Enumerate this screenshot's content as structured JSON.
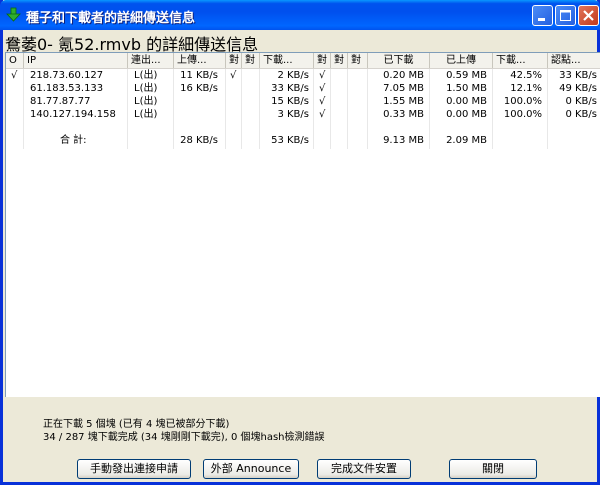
{
  "window": {
    "title": "種子和下載者的詳細傳送信息"
  },
  "file_title": "鴦萎0- 氪52.rmvb 的詳細傳送信息",
  "columns": [
    {
      "key": "o",
      "label": "O"
    },
    {
      "key": "ip",
      "label": "IP"
    },
    {
      "key": "conn",
      "label": "連出..."
    },
    {
      "key": "up",
      "label": "上傳..."
    },
    {
      "key": "c1",
      "label": "對"
    },
    {
      "key": "c2",
      "label": "對"
    },
    {
      "key": "down",
      "label": "下載..."
    },
    {
      "key": "c3",
      "label": "對"
    },
    {
      "key": "c4",
      "label": "對"
    },
    {
      "key": "c5",
      "label": "對"
    },
    {
      "key": "downloaded",
      "label": "已下載"
    },
    {
      "key": "uploaded",
      "label": "已上傳"
    },
    {
      "key": "dlpct",
      "label": "下載..."
    },
    {
      "key": "rate",
      "label": "認點..."
    }
  ],
  "rows": [
    {
      "o": "√",
      "ip": "218.73.60.127",
      "conn": "L(出)",
      "up": "11 KB/s",
      "c1": "√",
      "down": "2 KB/s",
      "c3": "√",
      "downloaded": "0.20 MB",
      "uploaded": "0.59 MB",
      "dlpct": "42.5%",
      "rate": "33 KB/s"
    },
    {
      "o": "",
      "ip": "61.183.53.133",
      "conn": "L(出)",
      "up": "16 KB/s",
      "c1": "",
      "down": "33 KB/s",
      "c3": "√",
      "downloaded": "7.05 MB",
      "uploaded": "1.50 MB",
      "dlpct": "12.1%",
      "rate": "49 KB/s"
    },
    {
      "o": "",
      "ip": "81.77.87.77",
      "conn": "L(出)",
      "up": "",
      "c1": "",
      "down": "15 KB/s",
      "c3": "√",
      "downloaded": "1.55 MB",
      "uploaded": "0.00 MB",
      "dlpct": "100.0%",
      "rate": "0 KB/s"
    },
    {
      "o": "",
      "ip": "140.127.194.158",
      "conn": "L(出)",
      "up": "",
      "c1": "",
      "down": "3 KB/s",
      "c3": "√",
      "downloaded": "0.33 MB",
      "uploaded": "0.00 MB",
      "dlpct": "100.0%",
      "rate": "0 KB/s"
    }
  ],
  "total": {
    "label": "合 計:",
    "up": "28 KB/s",
    "down": "53 KB/s",
    "downloaded": "9.13 MB",
    "uploaded": "2.09 MB"
  },
  "status": {
    "line1": "正在下載 5 個塊 (已有 4 塊已被部分下載)",
    "line2": "34 / 287 塊下載完成 (34 塊剛剛下載完), 0 個塊hash檢測錯誤"
  },
  "buttons": {
    "manual": "手動發出連接申請",
    "announce": "外部 Announce",
    "complete": "完成文件安置",
    "close": "關閉"
  },
  "icons": {
    "title": "download-arrow-icon",
    "minimize": "minimize-icon",
    "maximize": "maximize-icon",
    "close": "close-icon"
  }
}
